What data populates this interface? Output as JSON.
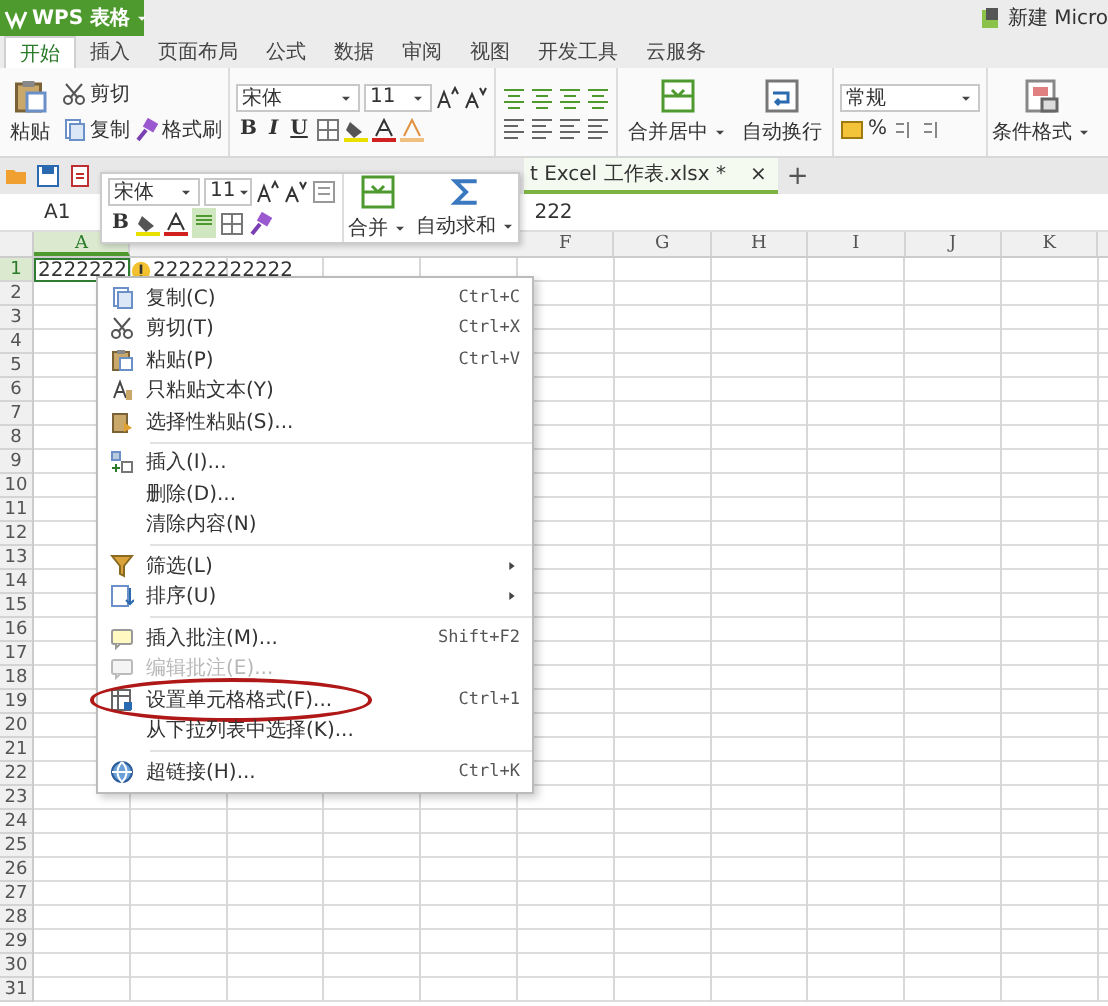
{
  "app_button": {
    "label": "WPS 表格"
  },
  "title_right": "新建 Micro",
  "ribbon_tabs": [
    {
      "label": "开始",
      "selected": true
    },
    {
      "label": "插入",
      "selected": false
    },
    {
      "label": "页面布局",
      "selected": false
    },
    {
      "label": "公式",
      "selected": false
    },
    {
      "label": "数据",
      "selected": false
    },
    {
      "label": "审阅",
      "selected": false
    },
    {
      "label": "视图",
      "selected": false
    },
    {
      "label": "开发工具",
      "selected": false
    },
    {
      "label": "云服务",
      "selected": false
    }
  ],
  "ribbon": {
    "paste": "粘贴",
    "cut": "剪切",
    "copy": "复制",
    "format_painter": "格式刷",
    "font": "宋体",
    "font_size": "11",
    "bold": "B",
    "italic": "I",
    "underline": "U",
    "merge": "合并居中",
    "wrap": "自动换行",
    "number_format": "常规",
    "percent": "%",
    "conditional": "条件格式"
  },
  "doc_tab": {
    "label": "t Excel 工作表.xlsx *",
    "close": "×",
    "add": "+"
  },
  "formula_bar": {
    "cell_ref": "A1",
    "value": "222"
  },
  "mini_toolbar": {
    "font": "宋体",
    "font_size": "11",
    "bold": "B",
    "merge": "合并",
    "autosum": "自动求和"
  },
  "columns": [
    {
      "label": "A",
      "selected": true
    },
    {
      "label": "F",
      "selected": false
    },
    {
      "label": "G",
      "selected": false
    },
    {
      "label": "H",
      "selected": false
    },
    {
      "label": "I",
      "selected": false
    },
    {
      "label": "J",
      "selected": false
    },
    {
      "label": "K",
      "selected": false
    }
  ],
  "rows": [
    {
      "label": "1",
      "selected": true
    },
    {
      "label": "2",
      "selected": false
    },
    {
      "label": "3",
      "selected": false
    },
    {
      "label": "4",
      "selected": false
    },
    {
      "label": "5",
      "selected": false
    },
    {
      "label": "6",
      "selected": false
    },
    {
      "label": "7",
      "selected": false
    },
    {
      "label": "8",
      "selected": false
    },
    {
      "label": "9",
      "selected": false
    },
    {
      "label": "10",
      "selected": false
    },
    {
      "label": "11",
      "selected": false
    },
    {
      "label": "12",
      "selected": false
    },
    {
      "label": "13",
      "selected": false
    },
    {
      "label": "14",
      "selected": false
    },
    {
      "label": "15",
      "selected": false
    },
    {
      "label": "16",
      "selected": false
    },
    {
      "label": "17",
      "selected": false
    },
    {
      "label": "18",
      "selected": false
    },
    {
      "label": "19",
      "selected": false
    },
    {
      "label": "20",
      "selected": false
    },
    {
      "label": "21",
      "selected": false
    },
    {
      "label": "22",
      "selected": false
    },
    {
      "label": "23",
      "selected": false
    },
    {
      "label": "24",
      "selected": false
    },
    {
      "label": "25",
      "selected": false
    },
    {
      "label": "26",
      "selected": false
    },
    {
      "label": "27",
      "selected": false
    },
    {
      "label": "28",
      "selected": false
    },
    {
      "label": "29",
      "selected": false
    },
    {
      "label": "30",
      "selected": false
    },
    {
      "label": "31",
      "selected": false
    }
  ],
  "cell_a1": {
    "before_icon": "2222222",
    "after_icon": "22222222222"
  },
  "context_menu": {
    "items": [
      {
        "kind": "item",
        "label": "复制(C)",
        "shortcut": "Ctrl+C",
        "submenu": false,
        "disabled": false,
        "circled": false
      },
      {
        "kind": "item",
        "label": "剪切(T)",
        "shortcut": "Ctrl+X",
        "submenu": false,
        "disabled": false,
        "circled": false
      },
      {
        "kind": "item",
        "label": "粘贴(P)",
        "shortcut": "Ctrl+V",
        "submenu": false,
        "disabled": false,
        "circled": false
      },
      {
        "kind": "item",
        "label": "只粘贴文本(Y)",
        "submenu": false,
        "disabled": false,
        "circled": false
      },
      {
        "kind": "item",
        "label": "选择性粘贴(S)...",
        "submenu": false,
        "disabled": false,
        "circled": false
      },
      {
        "kind": "separator"
      },
      {
        "kind": "item",
        "label": "插入(I)...",
        "submenu": false,
        "disabled": false,
        "circled": false
      },
      {
        "kind": "item",
        "label": "删除(D)...",
        "submenu": false,
        "disabled": false,
        "circled": false
      },
      {
        "kind": "item",
        "label": "清除内容(N)",
        "submenu": false,
        "disabled": false,
        "circled": false
      },
      {
        "kind": "separator"
      },
      {
        "kind": "item",
        "label": "筛选(L)",
        "submenu": true,
        "disabled": false,
        "circled": false
      },
      {
        "kind": "item",
        "label": "排序(U)",
        "submenu": true,
        "disabled": false,
        "circled": false
      },
      {
        "kind": "separator"
      },
      {
        "kind": "item",
        "label": "插入批注(M)...",
        "shortcut": "Shift+F2",
        "submenu": false,
        "disabled": false,
        "circled": false
      },
      {
        "kind": "item",
        "label": "编辑批注(E)...",
        "submenu": false,
        "disabled": true,
        "circled": false
      },
      {
        "kind": "item",
        "label": "设置单元格格式(F)...",
        "shortcut": "Ctrl+1",
        "submenu": false,
        "disabled": false,
        "circled": true
      },
      {
        "kind": "item",
        "label": "从下拉列表中选择(K)...",
        "submenu": false,
        "disabled": false,
        "circled": false
      },
      {
        "kind": "separator"
      },
      {
        "kind": "item",
        "label": "超链接(H)...",
        "shortcut": "Ctrl+K",
        "submenu": false,
        "disabled": false,
        "circled": false
      }
    ]
  }
}
